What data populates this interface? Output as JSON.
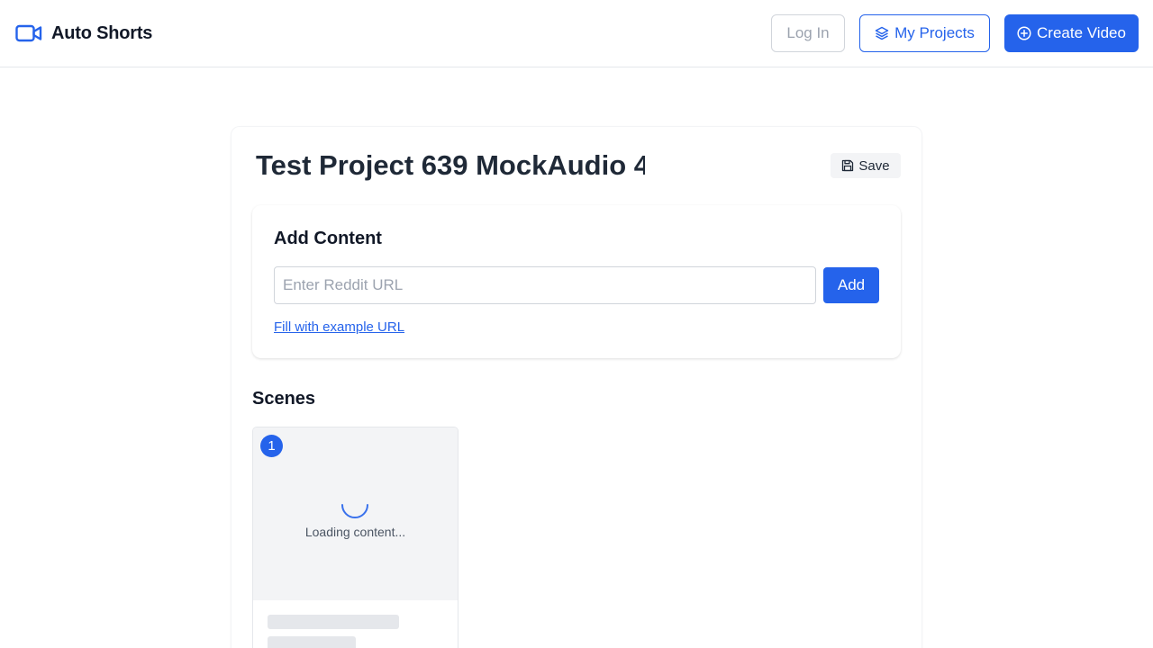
{
  "header": {
    "brand_name": "Auto Shorts",
    "brand_icon": "video-camera-icon",
    "login_label": "Log In",
    "projects_label": "My Projects",
    "projects_icon": "layers-icon",
    "create_label": "Create Video",
    "create_icon": "plus-circle-icon"
  },
  "project": {
    "title": "Test Project 639 MockAudio 4",
    "save_label": "Save",
    "save_icon": "floppy-disk-icon"
  },
  "add_content": {
    "title": "Add Content",
    "url_placeholder": "Enter Reddit URL",
    "url_value": "",
    "add_label": "Add",
    "fill_example_label": "Fill with example URL"
  },
  "scenes": {
    "title": "Scenes",
    "items": [
      {
        "number": "1",
        "loading_text": "Loading content..."
      }
    ]
  },
  "colors": {
    "accent": "#2563eb",
    "text": "#111827",
    "muted": "#9ca3af",
    "panel_bg": "#f3f4f6"
  }
}
